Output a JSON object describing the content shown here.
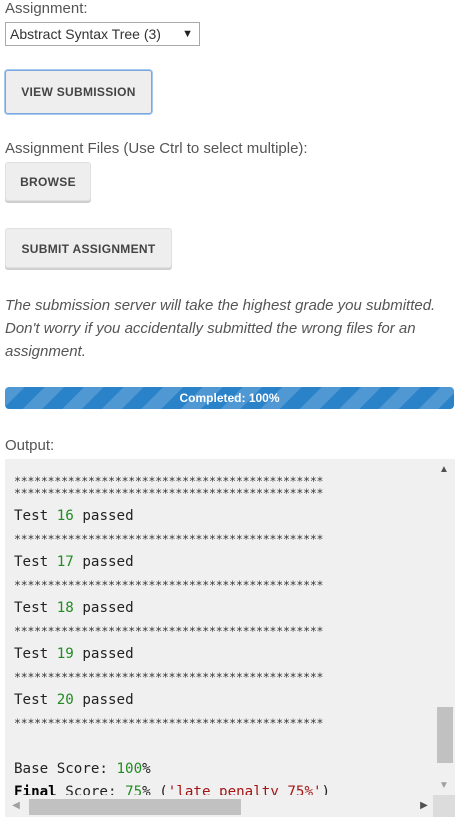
{
  "assignment": {
    "label": "Assignment:",
    "selected": "Abstract Syntax Tree (3)"
  },
  "buttons": {
    "view_submission": "VIEW SUBMISSION",
    "browse": "BROWSE",
    "submit_assignment": "SUBMIT ASSIGNMENT"
  },
  "files_label": "Assignment Files (Use Ctrl to select multiple):",
  "note": "The submission server will take the highest grade you submitted. Don't worry if you accidentally submitted the wrong files for an assignment.",
  "progress": {
    "text": "Completed: 100%",
    "percent": 100,
    "color": "#2a82c9"
  },
  "output": {
    "label": "Output:",
    "stars": "**********************************************",
    "tests": [
      {
        "word": "Test",
        "num": "16",
        "status": "passed"
      },
      {
        "word": "Test",
        "num": "17",
        "status": "passed"
      },
      {
        "word": "Test",
        "num": "18",
        "status": "passed"
      },
      {
        "word": "Test",
        "num": "19",
        "status": "passed"
      },
      {
        "word": "Test",
        "num": "20",
        "status": "passed"
      }
    ],
    "base_score": {
      "label": "Base Score:",
      "value": "100",
      "unit": "%"
    },
    "final_score": {
      "kw": "Final",
      "label": "Score:",
      "value": "75",
      "unit": "%",
      "open": "(",
      "note": "'late penalty 75%'",
      "close": ")"
    }
  }
}
